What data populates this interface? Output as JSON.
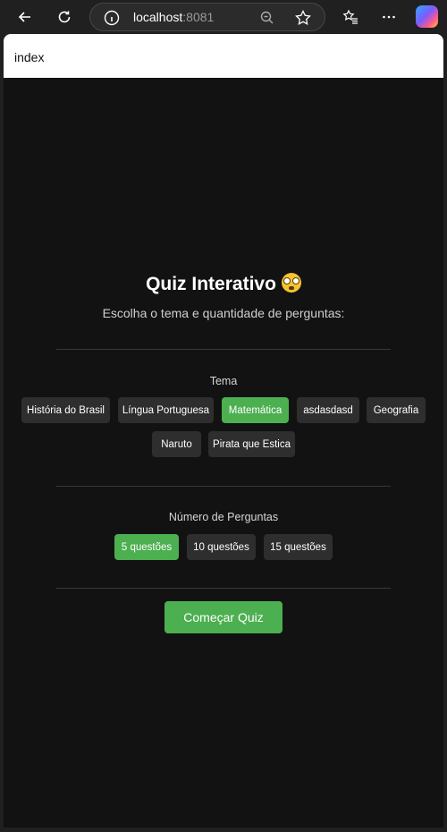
{
  "browser": {
    "url_host": "localhost",
    "url_port": ":8081"
  },
  "page": {
    "tab_title": "index"
  },
  "quiz": {
    "title": "Quiz Interativo",
    "subtitle": "Escolha o tema e quantidade de perguntas:",
    "theme_label": "Tema",
    "themes": [
      {
        "label": "História do Brasil",
        "selected": false
      },
      {
        "label": "Língua Portuguesa",
        "selected": false
      },
      {
        "label": "Matemática",
        "selected": true
      },
      {
        "label": "asdasdasd",
        "selected": false
      },
      {
        "label": "Geografia",
        "selected": false
      },
      {
        "label": "Naruto",
        "selected": false
      },
      {
        "label": "Pirata que Estica",
        "selected": false
      }
    ],
    "count_label": "Número de Perguntas",
    "counts": [
      {
        "label": "5 questões",
        "selected": true
      },
      {
        "label": "10 questões",
        "selected": false
      },
      {
        "label": "15 questões",
        "selected": false
      }
    ],
    "start_label": "Começar Quiz"
  },
  "colors": {
    "accent": "#4caf50",
    "chip": "#2e2e2e",
    "page_bg": "#121212"
  }
}
